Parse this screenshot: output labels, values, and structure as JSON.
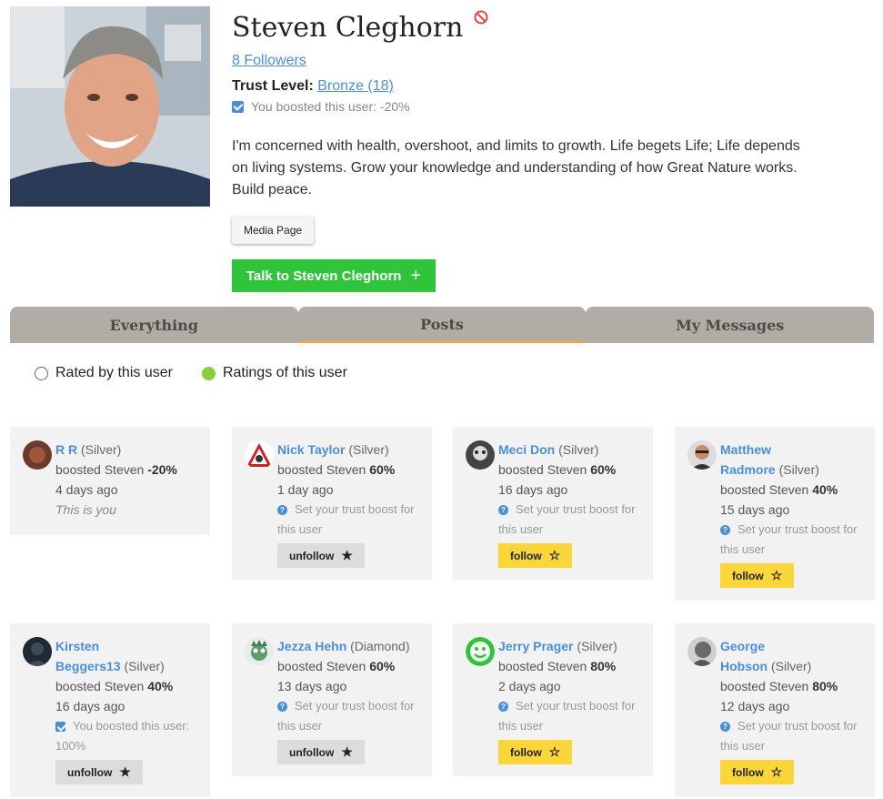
{
  "profile": {
    "name": "Steven Cleghorn",
    "followers": "8 Followers",
    "trust_label": "Trust Level:",
    "trust_value": "Bronze (18)",
    "boost_note": "You boosted this user: -20%",
    "bio": "I'm concerned with health, overshoot, and limits to growth. Life begets Life; Life depends on living systems. Grow your knowledge and understanding of how Great Nature works. Build peace.",
    "media_button": "Media Page",
    "talk_button": "Talk to Steven Cleghorn",
    "talk_icon": "plus-icon",
    "block_icon": "block-icon"
  },
  "tabs": [
    {
      "label": "Everything",
      "active": false
    },
    {
      "label": "Posts",
      "active": true
    },
    {
      "label": "My Messages",
      "active": false
    }
  ],
  "filters": [
    {
      "label": "Rated by this user",
      "selected": false
    },
    {
      "label": "Ratings of this user",
      "selected": true
    }
  ],
  "cards": [
    {
      "name": "R R",
      "level": "(Silver)",
      "boost_prefix": "boosted Steven",
      "boost": "-20%",
      "ago": "4 days ago",
      "extra": "This is you"
    },
    {
      "name": "Nick Taylor",
      "level": "(Silver)",
      "boost_prefix": "boosted Steven",
      "boost": "60%",
      "ago": "1 day ago",
      "hint": "Set your trust boost for",
      "hint2": "this user",
      "button": "unfollow"
    },
    {
      "name": "Meci Don",
      "level": "(Silver)",
      "boost_prefix": "boosted Steven",
      "boost": "60%",
      "ago": "16 days ago",
      "hint": "Set your trust boost for",
      "hint2": "this user",
      "button": "follow"
    },
    {
      "name": "Matthew Radmore",
      "name_l1": "Matthew",
      "name_l2": "Radmore",
      "level": "(Silver)",
      "boost_prefix": "boosted Steven",
      "boost": "40%",
      "ago": "15 days ago",
      "hint": "Set your trust boost for",
      "hint2": "this user",
      "button": "follow"
    },
    {
      "name": "Kirsten Beggers13",
      "name_l1": "Kirsten",
      "name_l2": "Beggers13",
      "level": "(Silver)",
      "boost_prefix": "boosted Steven",
      "boost": "40%",
      "ago": "16 days ago",
      "boosted_note": "You boosted this user:",
      "boosted_value": "100%",
      "button": "unfollow"
    },
    {
      "name": "Jezza Hehn",
      "level": "(Diamond)",
      "boost_prefix": "boosted Steven",
      "boost": "60%",
      "ago": "13 days ago",
      "hint": "Set your trust boost for",
      "hint2": "this user",
      "button": "unfollow"
    },
    {
      "name": "Jerry Prager",
      "level": "(Silver)",
      "boost_prefix": "boosted Steven",
      "boost": "80%",
      "ago": "2 days ago",
      "hint": "Set your trust boost for",
      "hint2": "this user",
      "button": "follow"
    },
    {
      "name": "George Hobson",
      "name_l1": "George",
      "name_l2": "Hobson",
      "level": "(Silver)",
      "boost_prefix": "boosted Steven",
      "boost": "80%",
      "ago": "12 days ago",
      "hint": "Set your trust boost for",
      "hint2": "this user",
      "button": "follow"
    }
  ],
  "colors": {
    "link": "#4a8ed8",
    "talk_green": "#2fc43a",
    "follow_yellow": "#fbd63a",
    "tab_bg": "#b2aca6",
    "tab_active_line": "#f5a623",
    "card_bg": "#f2f2f2"
  }
}
